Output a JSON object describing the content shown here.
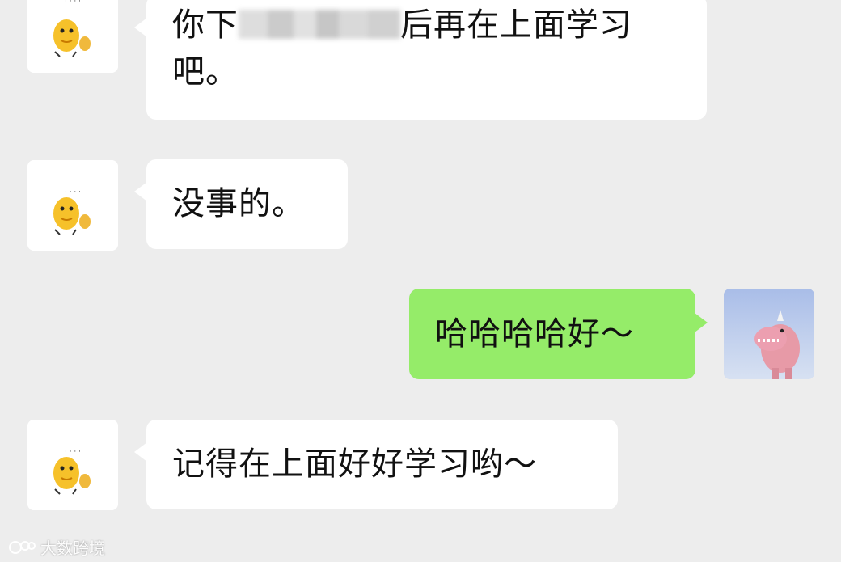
{
  "chat": {
    "messages": [
      {
        "sender": "other",
        "avatar": "yellow-cartoon-avatar",
        "line1_prefix": "你下",
        "line1_suffix": "后再在上面学习",
        "line2": "吧。"
      },
      {
        "sender": "other",
        "avatar": "yellow-cartoon-avatar",
        "text": "没事的。"
      },
      {
        "sender": "me",
        "avatar": "pink-plush-avatar",
        "text": "哈哈哈哈好～"
      },
      {
        "sender": "other",
        "avatar": "yellow-cartoon-avatar",
        "text": "记得在上面好好学习哟～"
      }
    ]
  },
  "watermark": {
    "text": "大数跨境"
  },
  "colors": {
    "background": "#ededed",
    "bubble_other": "#ffffff",
    "bubble_me": "#95ec69"
  }
}
